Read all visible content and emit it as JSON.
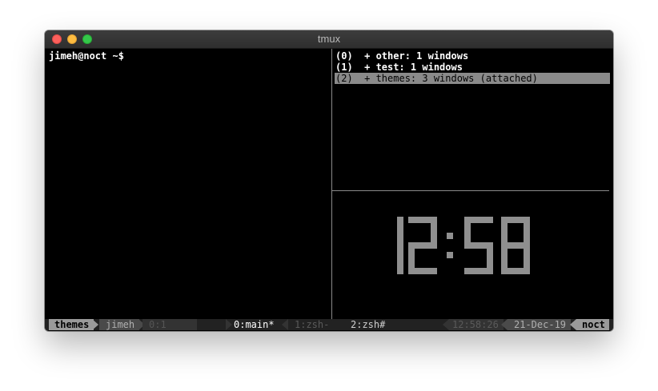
{
  "window": {
    "title": "tmux"
  },
  "left_pane": {
    "prompt": "jimeh@noct ~$"
  },
  "session_list": [
    {
      "label": "(0)  + other: 1 windows",
      "selected": false
    },
    {
      "label": "(1)  + test: 1 windows",
      "selected": false
    },
    {
      "label": "(2)  + themes: 3 windows (attached)",
      "selected": true
    }
  ],
  "clock": {
    "time": "12:58",
    "color": "#8f8f8f"
  },
  "status": {
    "session": "themes",
    "user": "jimeh",
    "pane": "0:1",
    "windows": [
      {
        "label": "0:main*",
        "active": true
      },
      {
        "label": "1:zsh-",
        "active": false
      },
      {
        "label": "2:zsh#",
        "active": false
      }
    ],
    "time": "12:58:26",
    "date": "21-Dec-19",
    "host": "noct"
  },
  "colors": {
    "close": "#fc605c",
    "minimize": "#fdbc40",
    "maximize": "#34c84a",
    "accent_gray": "#8a8a8a"
  }
}
